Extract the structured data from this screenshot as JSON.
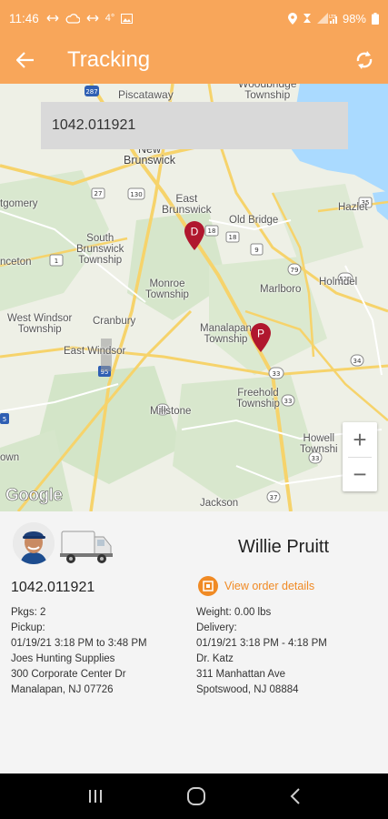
{
  "status_bar": {
    "time": "11:46",
    "temperature": "4°",
    "battery": "98%",
    "icons": [
      "sync-arrows-icon",
      "cloud-icon",
      "sync-arrows-icon",
      "image-icon",
      "location-icon",
      "alarm-icon",
      "signal-icon",
      "battery-icon"
    ]
  },
  "app_bar": {
    "title": "Tracking",
    "back_icon": "arrow-left-icon",
    "refresh_icon": "refresh-icon",
    "color": "#f8a65a"
  },
  "map": {
    "search_value": "1042.011921",
    "zoom_in": "+",
    "zoom_out": "−",
    "attribution": "Google",
    "labels": {
      "piscataway": "Piscataway",
      "woodbridge": "Woodbridge\nTownship",
      "new_brunswick": "New\nBrunswick",
      "east_brunswick": "East\nBrunswick",
      "old_bridge": "Old Bridge",
      "hazlet": "Hazlet",
      "south_brunswick": "South\nBrunswick\nTownship",
      "montgomery": "tgomery",
      "princeton": "nceton",
      "monroe": "Monroe\nTownship",
      "marlboro": "Marlboro",
      "holmdel": "Holmdel",
      "west_windsor": "West Windsor\nTownship",
      "cranbury": "Cranbury",
      "manalapan": "Manalapan\nTownship",
      "east_windsor": "East Windsor",
      "freehold": "Freehold\nTownship",
      "millstone": "Millstone",
      "howell": "Howell\nTownshi",
      "jackson": "Jackson",
      "ewing": "own"
    },
    "pins": [
      {
        "letter": "D",
        "color": "#b0172e"
      },
      {
        "letter": "P",
        "color": "#b0172e"
      }
    ]
  },
  "details": {
    "driver_name": "Willie Pruitt",
    "order_id": "1042.011921",
    "view_order_label": "View order details",
    "link_color": "#f08a24",
    "pickup": {
      "pkgs": "Pkgs: 2",
      "label": "Pickup:",
      "window": "01/19/21 3:18 PM to 3:48 PM",
      "name": "Joes Hunting Supplies",
      "address1": "300 Corporate Center Dr",
      "address2": "Manalapan, NJ 07726"
    },
    "delivery": {
      "weight": "Weight: 0.00 lbs",
      "label": "Delivery:",
      "window": "01/19/21 3:18 PM - 4:18 PM",
      "name": "Dr. Katz",
      "address1": "311 Manhattan Ave",
      "address2": "Spotswood, NJ 08884"
    }
  },
  "nav_bar": {
    "icons": [
      "recents-icon",
      "home-icon",
      "back-icon"
    ]
  }
}
